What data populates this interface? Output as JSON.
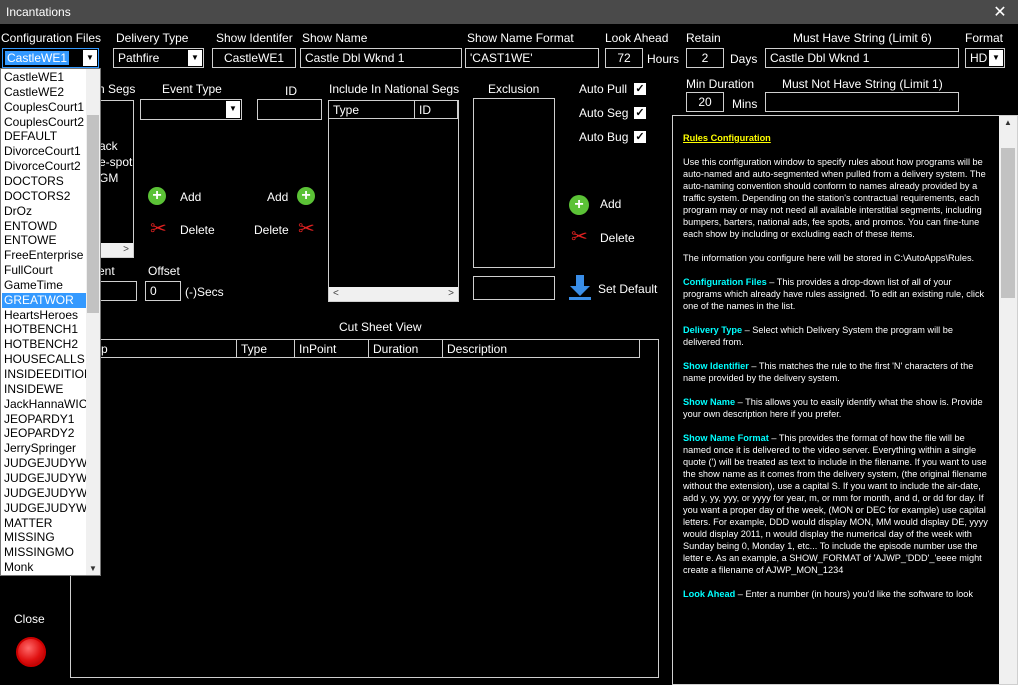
{
  "window": {
    "title": "Incantations",
    "close_glyph": "✕"
  },
  "labels": {
    "config_files": "Configuration Files",
    "delivery_type": "Delivery Type",
    "show_identifier": "Show Identifer",
    "show_name": "Show Name",
    "show_name_format": "Show Name Format",
    "look_ahead": "Look Ahead",
    "hours": "Hours",
    "retain": "Retain",
    "days": "Days",
    "must_have": "Must Have String (Limit 6)",
    "format": "Format",
    "min_duration": "Min Duration",
    "mins": "Mins",
    "must_not_have": "Must Not Have String (Limit 1)",
    "segs_partial": "n Segs",
    "event_type": "Event Type",
    "id": "ID",
    "include_national": "Include In National Segs",
    "exclusion": "Exclusion",
    "auto_pull": "Auto Pull",
    "auto_seg": "Auto Seg",
    "auto_bug": "Auto Bug",
    "segment_partial": "ment",
    "offset": "Offset",
    "secs": "(-)Secs",
    "cut_sheet_view": "Cut Sheet View",
    "close": "Close"
  },
  "fields": {
    "config_files_value": "CastleWE1",
    "delivery_type_value": "Pathfire",
    "show_identifier_value": "CastleWE1",
    "show_name_value": "Castle Dbl Wknd 1",
    "show_name_format_value": "'CAST1WE'",
    "look_ahead_value": "72",
    "retain_value": "2",
    "must_have_value": "Castle Dbl Wknd 1",
    "format_value": "HD",
    "min_duration_value": "20",
    "must_not_have_value": "",
    "event_type_value": "",
    "id_value": "",
    "exclusion_value": "",
    "segment_value": "",
    "offset_value": "0"
  },
  "segs_list_partial": [
    "ack",
    "e-spot",
    "GM"
  ],
  "national_table": {
    "headers": [
      "Type",
      "ID"
    ]
  },
  "cut_sheet": {
    "headers": [
      "p",
      "Type",
      "InPoint",
      "Duration",
      "Description"
    ]
  },
  "buttons": {
    "add": "Add",
    "delete": "Delete",
    "set_default": "Set Default"
  },
  "checkboxes": {
    "auto_pull": true,
    "auto_seg": true,
    "auto_bug": true,
    "glyph": "✓"
  },
  "dropdown_items": [
    "CastleWE1",
    "CastleWE2",
    "CouplesCourt1",
    "CouplesCourt2",
    "DEFAULT",
    "DivorceCourt1",
    "DivorceCourt2",
    "DOCTORS",
    "DOCTORS2",
    "DrOz",
    "ENTOWD",
    "ENTOWE",
    "FreeEnterprise",
    "FullCourt",
    "GameTime",
    "GREATWOR",
    "HeartsHeroes",
    "HOTBENCH1",
    "HOTBENCH2",
    "HOUSECALLS",
    "INSIDEEDITION",
    "INSIDEWE",
    "JackHannaWIC",
    "JEOPARDY1",
    "JEOPARDY2",
    "JerrySpringer",
    "JUDGEJUDYW",
    "JUDGEJUDYW",
    "JUDGEJUDYW",
    "JUDGEJUDYW",
    "MATTER",
    "MISSING",
    "MISSINGMO",
    "Monk"
  ],
  "dropdown_selected_index": 15,
  "help": {
    "title": "Rules Configuration",
    "intro": "Use this configuration window to specify rules about how programs will be auto-named and auto-segmented when pulled from a delivery system. The auto-naming convention should conform to names already provided by a traffic system. Depending on the station's contractual requirements, each program may or may not need all available interstitial segments, including bumpers, barters, national ads, fee spots, and promos. You can fine-tune each show by including or excluding each of these items.",
    "storage": "The information you configure here will be stored in C:\\AutoApps\\Rules.",
    "sections": [
      {
        "term": "Configuration Files",
        "text": " – This provides a drop-down list of all of your programs which already have rules assigned. To edit an existing rule, click one of the names in the list."
      },
      {
        "term": "Delivery Type",
        "text": " – Select which Delivery System the program will be delivered from."
      },
      {
        "term": "Show Identifier",
        "text": " – This matches the rule to the first 'N' characters of the name provided by the delivery system."
      },
      {
        "term": "Show Name",
        "text": " – This allows you to easily identify what the show is. Provide your own description here if you prefer."
      },
      {
        "term": "Show Name Format",
        "text": " – This provides the format of how the file will be named once it is delivered to the video server. Everything within a single quote (') will be treated as text to include in the filename. If you want to use the show name as it comes from the delivery system, (the original filename without the extension), use a capital S. If you want to include the air-date, add y, yy, yyy, or yyyy for year, m, or mm for month, and d, or dd for day. If you want a proper day of the week, (MON or DEC for example) use capital letters. For example, DDD would display MON, MM would display DE, yyyy would display 2011, n would display the numerical day of the week with Sunday being 0, Monday 1, etc... To include the episode number use the letter e. As an example, a SHOW_FORMAT of 'AJWP_'DDD'_'eeee might create a filename of AJWP_MON_1234"
      },
      {
        "term": "Look Ahead",
        "text": " – Enter a number (in hours) you'd like the software to look"
      }
    ]
  },
  "icons": {
    "add_icon": "+",
    "scissors_icon": "✂",
    "arrow_down_icon": "▼",
    "arrow_left_icon": "<",
    "arrow_right_icon": ">",
    "arrow_up_icon": "▲"
  },
  "colors": {
    "help_title": "#ffff00",
    "help_term": "#00ffff",
    "selection": "#3399ff",
    "close_button": "#e01010",
    "add_icon": "#5bc236"
  }
}
